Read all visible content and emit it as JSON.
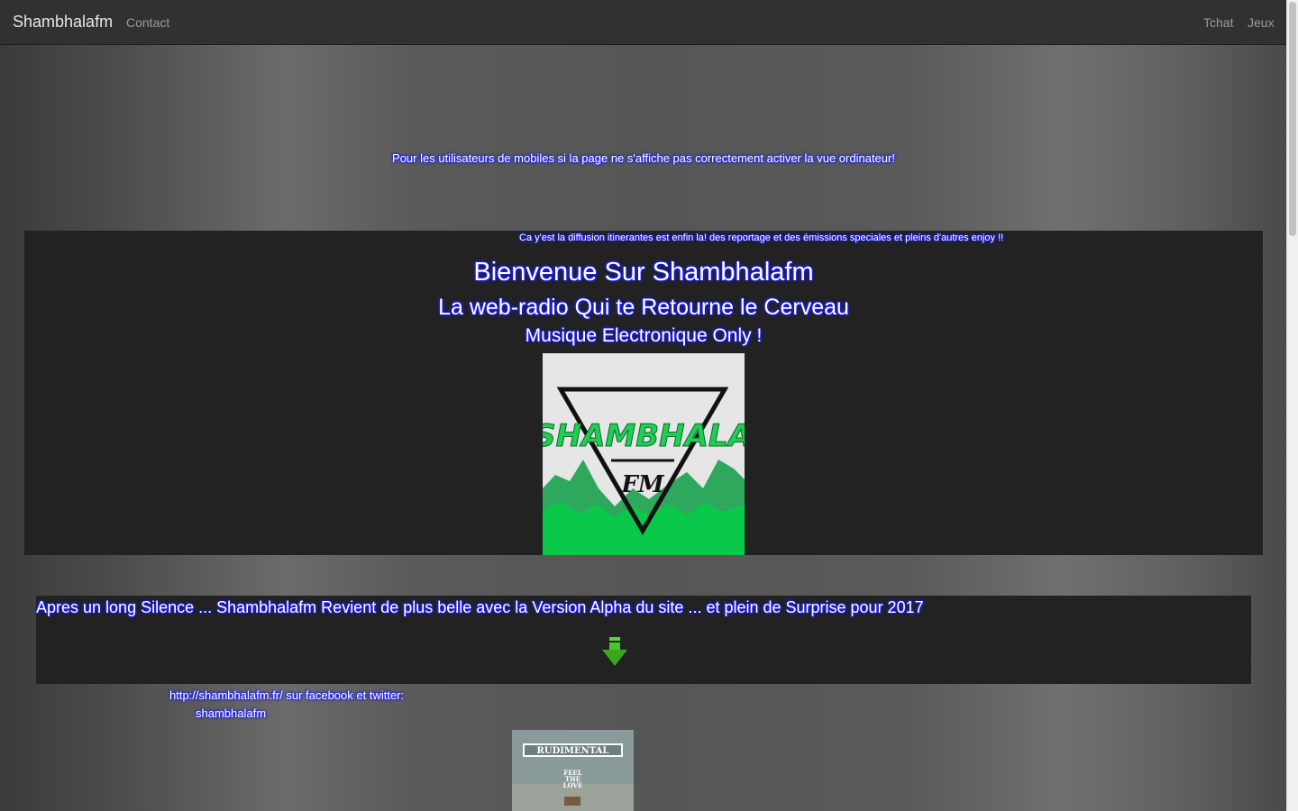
{
  "navbar": {
    "brand": "Shambhalafm",
    "left_links": [
      "Contact"
    ],
    "right_links": [
      "Tchat",
      "Jeux"
    ]
  },
  "mobile_notice": "Pour les utilisateurs de mobiles si la page ne s'affiche pas correctement activer la vue ordinateur!",
  "hero": {
    "marquee": "Ca y'est la diffusion itinerantes est enfin la! des reportage et des émissions speciales et pleins d'autres enjoy !!",
    "title": "Bienvenue Sur Shambhalafm",
    "subtitle": "La web-radio Qui te Retourne le Cerveau",
    "tagline": "Musique Electronique Only !",
    "logo_text_main": "SHAMBHALA",
    "logo_text_sub": "FM"
  },
  "news": {
    "text": "Apres un long Silence ... Shambhalafm Revient de plus belle avec la Version Alpha du site ... et plein de Surprise pour 2017",
    "arrow_icon": "arrow-down-icon"
  },
  "social": {
    "line": "http://shambhalafm.fr/ sur facebook et twitter:",
    "handle": "shambhalafm"
  },
  "album": {
    "artist": "RUDIMENTAL",
    "title_lines": [
      "FEEL",
      "THE",
      "LOVE"
    ]
  },
  "colors": {
    "navbar_bg": "#2f3133",
    "panel_bg": "#222222",
    "text_glow": "#1a1aff",
    "logo_green": "#0ac84a"
  }
}
